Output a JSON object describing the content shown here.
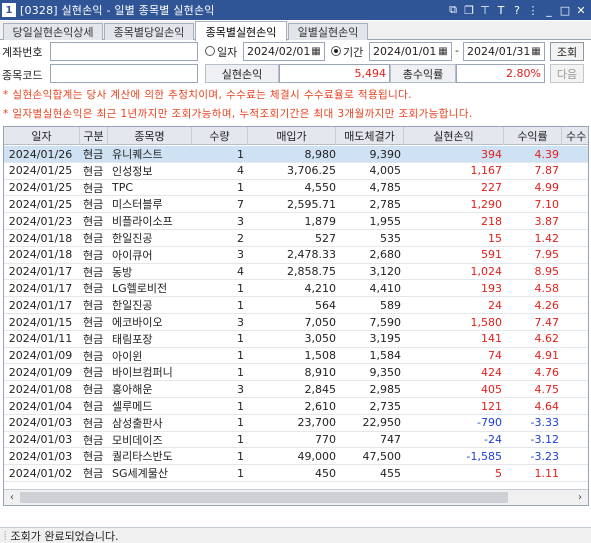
{
  "window": {
    "screen_no": "1",
    "title": "[0328] 실현손익 - 일별 종목별 실현손익",
    "icons": [
      "restore-icon",
      "copy-icon",
      "pin-icon",
      "font-icon",
      "help-icon",
      "minimize-icon",
      "maximize-icon",
      "close-icon"
    ]
  },
  "tabs": [
    {
      "label": "당일실현손익상세",
      "active": false
    },
    {
      "label": "종목별당일손익",
      "active": false
    },
    {
      "label": "종목별실현손익",
      "active": true
    },
    {
      "label": "일별실현손익",
      "active": false
    }
  ],
  "form": {
    "account_label": "계좌번호",
    "account_value": "",
    "code_label": "종목코드",
    "code_value": "",
    "radio_day_label": "일자",
    "day_date": "2024/02/01",
    "radio_period_label": "기간",
    "period_from": "2024/01/01",
    "period_sep": "-",
    "period_to": "2024/01/31",
    "search_button": "조회",
    "next_button": "다음",
    "pl_label": "실현손익",
    "pl_value": "5,494",
    "return_label": "총수익률",
    "return_value": "2.80%"
  },
  "notices": [
    "* 실현손익합계는 당사 계산에 의한 추정치이며, 수수료는 체결시 수수료율로 적용됩니다.",
    "* 일자별실현손익은 최근 1년까지만 조회가능하며, 누적조회기간은 최대 3개월까지만 조회가능합니다."
  ],
  "table": {
    "columns": [
      "일자",
      "구분",
      "종목명",
      "수량",
      "매입가",
      "매도체결가",
      "실현손익",
      "수익률",
      "수수"
    ],
    "rows": [
      {
        "date": "2024/01/26",
        "type": "현금",
        "name": "유니퀘스트",
        "qty": "1",
        "buy": "8,980",
        "sell": "9,390",
        "pl": "394",
        "rate": "4.39",
        "sign": "pos",
        "selected": true
      },
      {
        "date": "2024/01/25",
        "type": "현금",
        "name": "인성정보",
        "qty": "4",
        "buy": "3,706.25",
        "sell": "4,005",
        "pl": "1,167",
        "rate": "7.87",
        "sign": "pos",
        "selected": false
      },
      {
        "date": "2024/01/25",
        "type": "현금",
        "name": "TPC",
        "qty": "1",
        "buy": "4,550",
        "sell": "4,785",
        "pl": "227",
        "rate": "4.99",
        "sign": "pos",
        "selected": false
      },
      {
        "date": "2024/01/25",
        "type": "현금",
        "name": "미스터블루",
        "qty": "7",
        "buy": "2,595.71",
        "sell": "2,785",
        "pl": "1,290",
        "rate": "7.10",
        "sign": "pos",
        "selected": false
      },
      {
        "date": "2024/01/23",
        "type": "현금",
        "name": "비플라이소프",
        "qty": "3",
        "buy": "1,879",
        "sell": "1,955",
        "pl": "218",
        "rate": "3.87",
        "sign": "pos",
        "selected": false
      },
      {
        "date": "2024/01/18",
        "type": "현금",
        "name": "한일진공",
        "qty": "2",
        "buy": "527",
        "sell": "535",
        "pl": "15",
        "rate": "1.42",
        "sign": "pos",
        "selected": false
      },
      {
        "date": "2024/01/18",
        "type": "현금",
        "name": "아이큐어",
        "qty": "3",
        "buy": "2,478.33",
        "sell": "2,680",
        "pl": "591",
        "rate": "7.95",
        "sign": "pos",
        "selected": false
      },
      {
        "date": "2024/01/17",
        "type": "현금",
        "name": "동방",
        "qty": "4",
        "buy": "2,858.75",
        "sell": "3,120",
        "pl": "1,024",
        "rate": "8.95",
        "sign": "pos",
        "selected": false
      },
      {
        "date": "2024/01/17",
        "type": "현금",
        "name": "LG헬로비전",
        "qty": "1",
        "buy": "4,210",
        "sell": "4,410",
        "pl": "193",
        "rate": "4.58",
        "sign": "pos",
        "selected": false
      },
      {
        "date": "2024/01/17",
        "type": "현금",
        "name": "한일진공",
        "qty": "1",
        "buy": "564",
        "sell": "589",
        "pl": "24",
        "rate": "4.26",
        "sign": "pos",
        "selected": false
      },
      {
        "date": "2024/01/15",
        "type": "현금",
        "name": "에코바이오",
        "qty": "3",
        "buy": "7,050",
        "sell": "7,590",
        "pl": "1,580",
        "rate": "7.47",
        "sign": "pos",
        "selected": false
      },
      {
        "date": "2024/01/11",
        "type": "현금",
        "name": "태림포장",
        "qty": "1",
        "buy": "3,050",
        "sell": "3,195",
        "pl": "141",
        "rate": "4.62",
        "sign": "pos",
        "selected": false
      },
      {
        "date": "2024/01/09",
        "type": "현금",
        "name": "아이윈",
        "qty": "1",
        "buy": "1,508",
        "sell": "1,584",
        "pl": "74",
        "rate": "4.91",
        "sign": "pos",
        "selected": false
      },
      {
        "date": "2024/01/09",
        "type": "현금",
        "name": "바이브컴퍼니",
        "qty": "1",
        "buy": "8,910",
        "sell": "9,350",
        "pl": "424",
        "rate": "4.76",
        "sign": "pos",
        "selected": false
      },
      {
        "date": "2024/01/08",
        "type": "현금",
        "name": "홍아해운",
        "qty": "3",
        "buy": "2,845",
        "sell": "2,985",
        "pl": "405",
        "rate": "4.75",
        "sign": "pos",
        "selected": false
      },
      {
        "date": "2024/01/04",
        "type": "현금",
        "name": "셀루메드",
        "qty": "1",
        "buy": "2,610",
        "sell": "2,735",
        "pl": "121",
        "rate": "4.64",
        "sign": "pos",
        "selected": false
      },
      {
        "date": "2024/01/03",
        "type": "현금",
        "name": "삼성출판사",
        "qty": "1",
        "buy": "23,700",
        "sell": "22,950",
        "pl": "-790",
        "rate": "-3.33",
        "sign": "neg",
        "selected": false
      },
      {
        "date": "2024/01/03",
        "type": "현금",
        "name": "모비데이즈",
        "qty": "1",
        "buy": "770",
        "sell": "747",
        "pl": "-24",
        "rate": "-3.12",
        "sign": "neg",
        "selected": false
      },
      {
        "date": "2024/01/03",
        "type": "현금",
        "name": "퀄리타스반도",
        "qty": "1",
        "buy": "49,000",
        "sell": "47,500",
        "pl": "-1,585",
        "rate": "-3.23",
        "sign": "neg",
        "selected": false
      },
      {
        "date": "2024/01/02",
        "type": "현금",
        "name": "SG세계물산",
        "qty": "1",
        "buy": "450",
        "sell": "455",
        "pl": "5",
        "rate": "1.11",
        "sign": "pos",
        "selected": false
      }
    ]
  },
  "status": {
    "message": "조회가 완료되었습니다."
  },
  "colors": {
    "title_bar": "#2f5597",
    "positive": "#e0201c",
    "negative": "#1b3fd6",
    "selected_row": "#cfe2f3",
    "notice": "#e8421e"
  }
}
